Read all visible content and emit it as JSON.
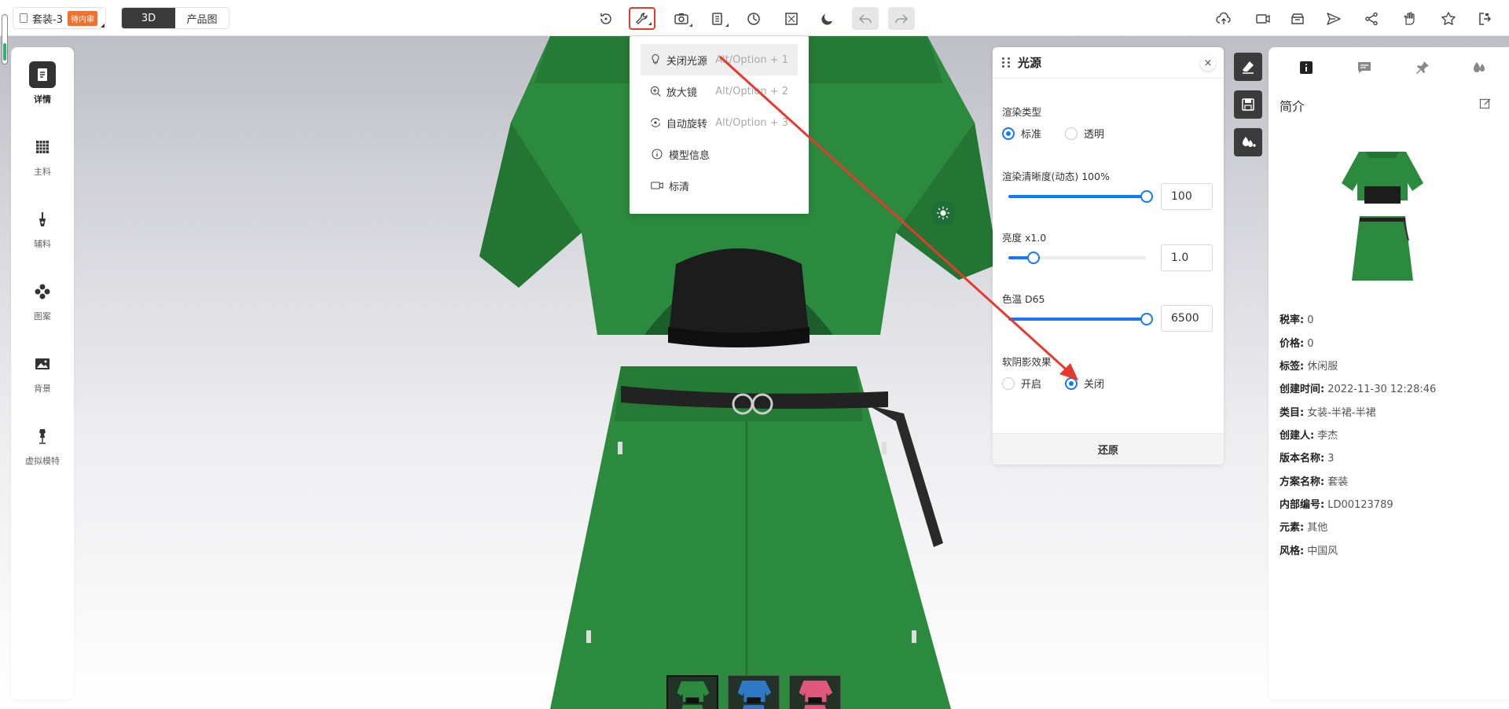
{
  "project": {
    "name": "套装-3",
    "badge": "待内审"
  },
  "view_toggle": {
    "active": "3D",
    "inactive": "产品图"
  },
  "toolbar_icons": [
    "reset-view-icon",
    "wrench-icon",
    "camera-icon",
    "pages-icon",
    "speed-icon",
    "fullscreen-icon",
    "moon-icon",
    "undo-icon",
    "redo-icon"
  ],
  "right_toolbar_icons": [
    "cloud-upload-icon",
    "video-icon",
    "save-box-icon",
    "send-icon",
    "share-icon",
    "hand-icon",
    "star-icon",
    "exit-icon"
  ],
  "sidebar": {
    "items": [
      {
        "label": "详情",
        "icon": "details-icon",
        "active": true
      },
      {
        "label": "主料",
        "icon": "fabric-grid-icon",
        "active": false
      },
      {
        "label": "辅料",
        "icon": "zipper-icon",
        "active": false
      },
      {
        "label": "图案",
        "icon": "pattern-icon",
        "active": false
      },
      {
        "label": "背景",
        "icon": "image-icon",
        "active": false
      },
      {
        "label": "虚拟模特",
        "icon": "mannequin-icon",
        "active": false
      }
    ]
  },
  "menu": {
    "items": [
      {
        "label": "关闭光源",
        "shortcut": "Alt/Option + 1",
        "icon": "bulb-icon"
      },
      {
        "label": "放大镜",
        "shortcut": "Alt/Option + 2",
        "icon": "magnifier-icon"
      },
      {
        "label": "自动旋转",
        "shortcut": "Alt/Option + 3",
        "icon": "rotate-icon"
      },
      {
        "label": "模型信息",
        "shortcut": "",
        "icon": "info-icon"
      },
      {
        "label": "标清",
        "shortcut": "",
        "icon": "video-quality-icon"
      }
    ]
  },
  "light_panel": {
    "title": "光源",
    "close": "×",
    "render_type_label": "渲染类型",
    "render_type_options": [
      "标准",
      "透明"
    ],
    "render_type_selected": "标准",
    "clarity_label": "渲染清晰度(动态) 100%",
    "clarity_value": "100",
    "clarity_fraction": 1.0,
    "brightness_label": "亮度 x1.0",
    "brightness_value": "1.0",
    "brightness_fraction": 0.18,
    "temp_label": "色温 D65",
    "temp_value": "6500",
    "temp_fraction": 1.0,
    "shadow_label": "软阴影效果",
    "shadow_options": [
      "开启",
      "关闭"
    ],
    "shadow_selected": "关闭",
    "reset": "还原",
    "accent": "#1677ff"
  },
  "info": {
    "title": "简介",
    "tab_icons": [
      "info-tab-icon",
      "comment-tab-icon",
      "pin-tab-icon",
      "drops-tab-icon"
    ],
    "fields": [
      {
        "k": "税率:",
        "v": "0"
      },
      {
        "k": "价格:",
        "v": "0"
      },
      {
        "k": "标签:",
        "v": "休闲服"
      },
      {
        "k": "创建时间:",
        "v": "2022-11-30 12:28:46"
      },
      {
        "k": "类目:",
        "v": "女装-半裙-半裙"
      },
      {
        "k": "创建人:",
        "v": "李杰"
      },
      {
        "k": "版本名称:",
        "v": "3"
      },
      {
        "k": "方案名称:",
        "v": "套装"
      },
      {
        "k": "内部编号:",
        "v": "LD00123789"
      },
      {
        "k": "元素:",
        "v": "其他"
      },
      {
        "k": "风格:",
        "v": "中国风"
      }
    ]
  },
  "colors": {
    "garment_green": "#2b8a3e",
    "highlight_red": "#e53a30"
  },
  "thumbnails": [
    "green-variant",
    "blue-variant",
    "pink-variant"
  ]
}
